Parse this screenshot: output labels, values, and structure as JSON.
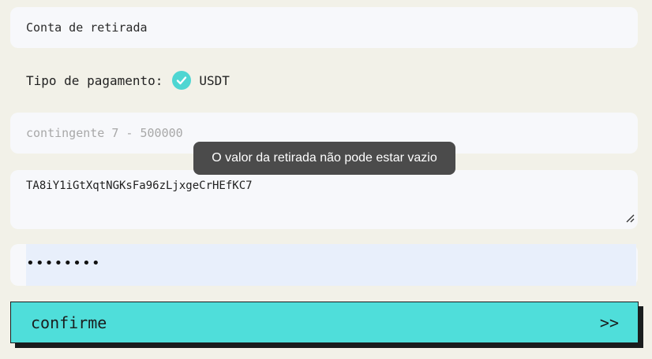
{
  "form": {
    "account_label": "Conta de retirada",
    "payment_type_label": "Tipo de pagamento:",
    "payment_option": "USDT",
    "amount_placeholder": "contingente 7 - 500000",
    "address_value": "TA8iY1iGtXqtNGKsFa96zLjxgeCrHEfKC7",
    "password_mask": "••••••••"
  },
  "tooltip": {
    "message": "O valor da retirada não pode estar vazio"
  },
  "confirm": {
    "label": "confirme",
    "arrows": ">>"
  },
  "icons": {
    "payment_selected": "check-circle-icon",
    "address_resize": "resize-handle-icon"
  },
  "colors": {
    "page_background": "#f2f1e8",
    "field_background": "#f7f8fb",
    "accent": "#4fdeda",
    "tooltip_background": "#4b4b4b",
    "password_autofill": "#e8effb"
  }
}
